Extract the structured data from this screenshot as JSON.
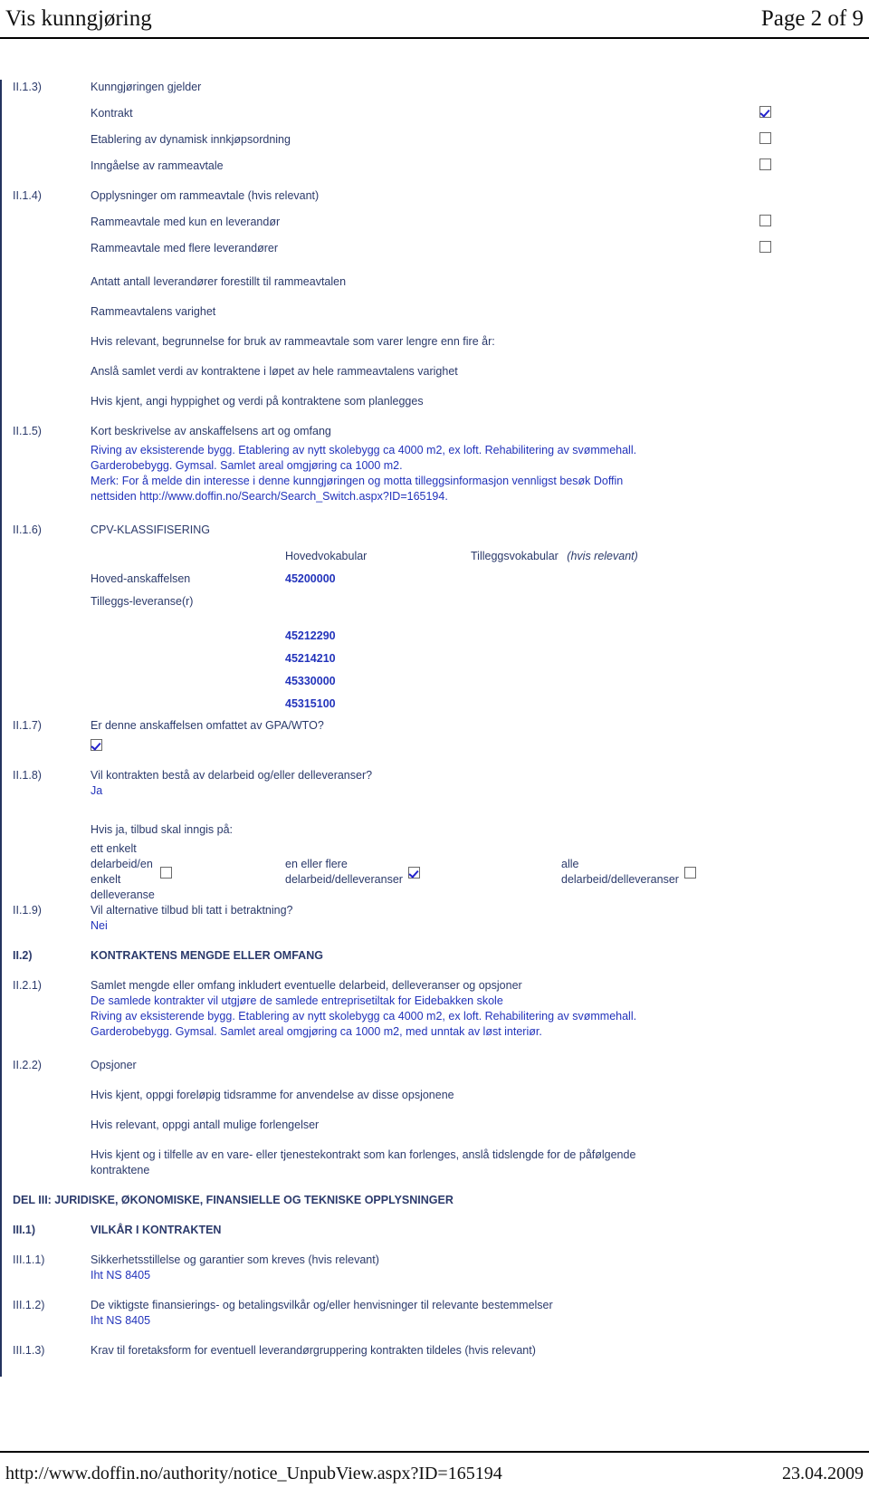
{
  "header": {
    "title": "Vis kunngjøring",
    "page_indicator": "Page 2 of 9"
  },
  "footer": {
    "url": "http://www.doffin.no/authority/notice_UnpubView.aspx?ID=165194",
    "date": "23.04.2009"
  },
  "colors": {
    "text": "#2b3a6b",
    "accent_blue": "#2233bb",
    "rule": "#000000",
    "checkbox_border": "#6a6a6a"
  },
  "sections": {
    "ii_1_3": {
      "label": "II.1.3)",
      "heading": "Kunngjøringen gjelder",
      "options": [
        {
          "text": "Kontrakt",
          "checked": true
        },
        {
          "text": "Etablering av dynamisk innkjøpsordning",
          "checked": false
        },
        {
          "text": "Inngåelse av rammeavtale",
          "checked": false
        }
      ]
    },
    "ii_1_4": {
      "label": "II.1.4)",
      "heading": "Opplysninger om rammeavtale (hvis relevant)",
      "options": [
        {
          "text": "Rammeavtale med kun en leverandør",
          "checked": false
        },
        {
          "text": "Rammeavtale med flere leverandører",
          "checked": false
        }
      ],
      "lines": [
        "Antatt antall leverandører forestillt til rammeavtalen",
        "Rammeavtalens varighet",
        "Hvis relevant, begrunnelse for bruk av rammeavtale som varer lengre enn fire år:",
        "Anslå samlet verdi av kontraktene i løpet av hele rammeavtalens varighet",
        "Hvis kjent, angi hyppighet og verdi på kontraktene som planlegges"
      ]
    },
    "ii_1_5": {
      "label": "II.1.5)",
      "heading": "Kort beskrivelse av anskaffelsens art og omfang",
      "body": [
        "Riving av eksisterende bygg. Etablering av nytt skolebygg ca 4000 m2, ex loft. Rehabilitering av svømmehall.",
        "Garderobebygg. Gymsal. Samlet areal omgjøring ca 1000 m2.",
        "Merk: For å melde din interesse i denne kunngjøringen og motta tilleggsinformasjon vennligst besøk Doffin",
        "nettsiden http://www.doffin.no/Search/Search_Switch.aspx?ID=165194."
      ]
    },
    "ii_1_6": {
      "label": "II.1.6)",
      "heading": "CPV-KLASSIFISERING",
      "col_headers": {
        "main": "Hovedvokabular",
        "supplementary": "Tilleggsvokabular",
        "supplementary_note": "(hvis relevant)"
      },
      "row_labels": {
        "main_object": "Hoved-anskaffelsen",
        "additional": "Tilleggs-leveranse(r)"
      },
      "main_code": "45200000",
      "additional_codes": [
        "45212290",
        "45214210",
        "45330000",
        "45315100"
      ]
    },
    "ii_1_7": {
      "label": "II.1.7)",
      "heading": "Er denne anskaffelsen omfattet av GPA/WTO?",
      "checked": true
    },
    "ii_1_8": {
      "label": "II.1.8)",
      "heading": "Vil kontrakten bestå av delarbeid og/eller delleveranser?",
      "answer": "Ja",
      "sub_heading": "Hvis ja, tilbud skal inngis på:",
      "options": [
        {
          "lines": [
            "ett enkelt",
            "delarbeid/en",
            "enkelt",
            "delleveranse"
          ],
          "checked": false
        },
        {
          "lines": [
            "en eller flere",
            "delarbeid/delleveranser"
          ],
          "checked": true
        },
        {
          "lines": [
            "alle",
            "delarbeid/delleveranser"
          ],
          "checked": false
        }
      ]
    },
    "ii_1_9": {
      "label": "II.1.9)",
      "heading": "Vil alternative tilbud bli tatt i betraktning?",
      "answer": "Nei"
    },
    "ii_2": {
      "label": "II.2)",
      "heading": "KONTRAKTENS MENGDE ELLER OMFANG"
    },
    "ii_2_1": {
      "label": "II.2.1)",
      "heading": "Samlet mengde eller omfang inkludert eventuelle delarbeid, delleveranser og opsjoner",
      "body": [
        "De samlede kontrakter vil utgjøre de samlede entreprisetiltak for Eidebakken skole",
        "Riving av eksisterende bygg. Etablering av nytt skolebygg ca 4000 m2, ex loft. Rehabilitering av svømmehall.",
        "Garderobebygg. Gymsal. Samlet areal omgjøring ca 1000 m2, med unntak av løst interiør."
      ]
    },
    "ii_2_2": {
      "label": "II.2.2)",
      "heading": "Opsjoner",
      "lines": [
        "Hvis kjent, oppgi foreløpig tidsramme for anvendelse av disse opsjonene",
        "Hvis relevant, oppgi antall mulige forlengelser",
        "Hvis kjent og i tilfelle av en vare- eller tjenestekontrakt som kan forlenges, anslå tidslengde for de påfølgende",
        "kontraktene"
      ]
    },
    "del_iii": {
      "title": "DEL III: JURIDISKE, ØKONOMISKE, FINANSIELLE OG TEKNISKE OPPLYSNINGER"
    },
    "iii_1": {
      "label": "III.1)",
      "heading": "VILKÅR I KONTRAKTEN"
    },
    "iii_1_1": {
      "label": "III.1.1)",
      "heading": "Sikkerhetsstillelse og garantier som kreves (hvis relevant)",
      "value": "Iht NS 8405"
    },
    "iii_1_2": {
      "label": "III.1.2)",
      "heading": "De viktigste finansierings- og betalingsvilkår og/eller henvisninger til relevante bestemmelser",
      "value": "Iht NS 8405"
    },
    "iii_1_3": {
      "label": "III.1.3)",
      "heading": "Krav til foretaksform for eventuell leverandørgruppering kontrakten tildeles (hvis relevant)"
    }
  }
}
